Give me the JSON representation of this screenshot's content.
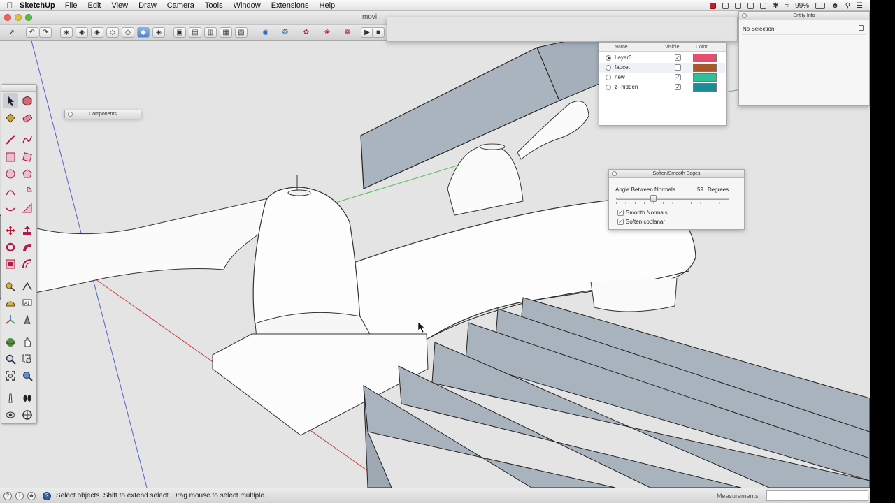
{
  "menubar": {
    "app_name": "SketchUp",
    "items": [
      "File",
      "Edit",
      "View",
      "Draw",
      "Camera",
      "Tools",
      "Window",
      "Extensions",
      "Help"
    ],
    "battery": "99%"
  },
  "window": {
    "title": "movi"
  },
  "toolbar": {
    "icons": [
      "select-icon",
      "undo-icon",
      "redo-icon",
      "standard-views",
      "face-styles",
      "section-tools",
      "solid-tools",
      "play-icon",
      "stop-icon"
    ]
  },
  "components_palette": {
    "title": "Components"
  },
  "layers": {
    "headers": {
      "name": "Name",
      "visible": "Visible",
      "color": "Color"
    },
    "rows": [
      {
        "name": "Layer0",
        "active": true,
        "visible": true,
        "color": "#e54e6c"
      },
      {
        "name": "faucet",
        "active": false,
        "visible": false,
        "color": "#a8572a"
      },
      {
        "name": "new",
        "active": false,
        "visible": true,
        "color": "#2fbf9a"
      },
      {
        "name": "z--hidden",
        "active": false,
        "visible": true,
        "color": "#1a8c96"
      }
    ]
  },
  "entity_info": {
    "title": "Entity Info",
    "selection": "No Selection"
  },
  "soften_panel": {
    "title": "Soften/Smooth Edges",
    "angle_label": "Angle Between Normals",
    "angle_value": "59",
    "angle_unit": "Degrees",
    "slider_fraction": 0.33,
    "options": [
      {
        "label": "Smooth Normals",
        "checked": true
      },
      {
        "label": "Soften coplanar",
        "checked": true
      }
    ]
  },
  "statusbar": {
    "message": "Select objects. Shift to extend select. Drag mouse to select multiple.",
    "measurements_label": "Measurements",
    "measurements_value": ""
  },
  "colors": {
    "accent": "#4f84cc",
    "viewport": "#e4e4e4",
    "panel_grey": "#aab4bf"
  }
}
